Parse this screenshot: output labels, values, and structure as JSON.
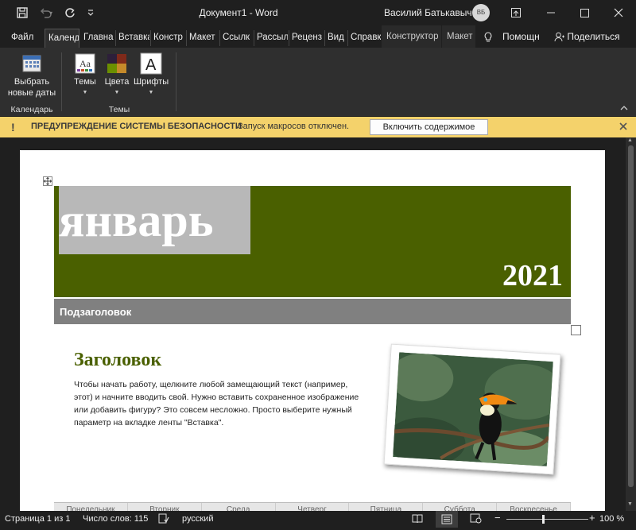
{
  "window": {
    "title": "Документ1  -  Word",
    "user_name": "Василий Батькавыч",
    "user_initials": "ВБ",
    "qat": {
      "save_icon": "save-icon",
      "undo_icon": "undo-icon",
      "redo_icon": "redo-icon",
      "customize_icon": "customize-qat-icon"
    },
    "controls": {
      "restore_ribbon": "ribbon-display-icon",
      "minimize": "minimize-icon",
      "maximize": "maximize-icon",
      "close": "close-icon"
    }
  },
  "tabs": [
    "Файл",
    "Календ",
    "Главна",
    "Вставка",
    "Констр",
    "Макет",
    "Ссылк",
    "Рассыл",
    "Реценз",
    "Вид",
    "Справк"
  ],
  "context_tabs": [
    "Конструктор",
    "Макет"
  ],
  "tell_me": "Помощн",
  "share": "Поделиться",
  "ribbon": {
    "groups": [
      {
        "label": "Календарь",
        "buttons": [
          {
            "label_line1": "Выбрать",
            "label_line2": "новые даты"
          }
        ]
      },
      {
        "label": "Темы",
        "buttons": [
          {
            "label": "Темы"
          },
          {
            "label": "Цвета"
          },
          {
            "label": "Шрифты"
          }
        ]
      }
    ],
    "theme_colors": [
      "#2d1f3a",
      "#7f2a1a",
      "#6b8f00",
      "#c58a2a"
    ],
    "accent": "#4a6000"
  },
  "warning": {
    "title": "ПРЕДУПРЕЖДЕНИЕ СИСТЕМЫ БЕЗОПАСНОСТИ",
    "message": "Запуск макросов отключен.",
    "button": "Включить содержимое",
    "bg_color": "#f4d26b"
  },
  "document": {
    "month": "январь",
    "year": "2021",
    "subtitle": "Подзаголовок",
    "heading": "Заголовок",
    "body": "Чтобы начать работу, щелкните любой замещающий текст (например, этот) и начните вводить свой. Нужно вставить сохраненное изображение или добавить фигуру? Это совсем несложно. Просто выберите нужный параметр на вкладке ленты \"Вставка\".",
    "weekdays": [
      "Понедельник",
      "Вторник",
      "Среда",
      "Четверг",
      "Пятница",
      "Суббота",
      "Воскресенье"
    ],
    "banner_color": "#4a6000"
  },
  "status": {
    "page": "Страница 1 из 1",
    "words": "Число слов: 115",
    "language": "русский",
    "zoom": "100 %",
    "zoom_value": 100
  }
}
